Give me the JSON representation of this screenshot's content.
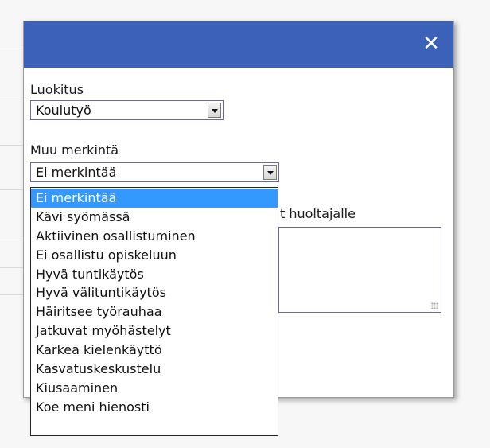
{
  "dialog": {
    "close_glyph": "✕"
  },
  "classification": {
    "label": "Luokitus",
    "selected": "Koulutyö"
  },
  "other_mark": {
    "label": "Muu merkintä",
    "selected": "Ei merkintää",
    "options": [
      "Ei merkintää",
      "Kävi syömässä",
      "Aktiivinen osallistuminen",
      "Ei osallistu opiskeluun",
      "Hyvä tuntikäytös",
      "Hyvä välituntikäytös",
      "Häiritsee työrauhaa",
      "Jatkuvat myöhästelyt",
      "Karkea kielenkäyttö",
      "Kasvatuskeskustelu",
      "Kiusaaminen",
      "Koe meni hienosti"
    ],
    "highlighted_index": 0
  },
  "guardian_note": {
    "label_visible": "t huoltajalle"
  },
  "colors": {
    "titlebar": "#3b62b8",
    "selection": "#3399ff"
  }
}
